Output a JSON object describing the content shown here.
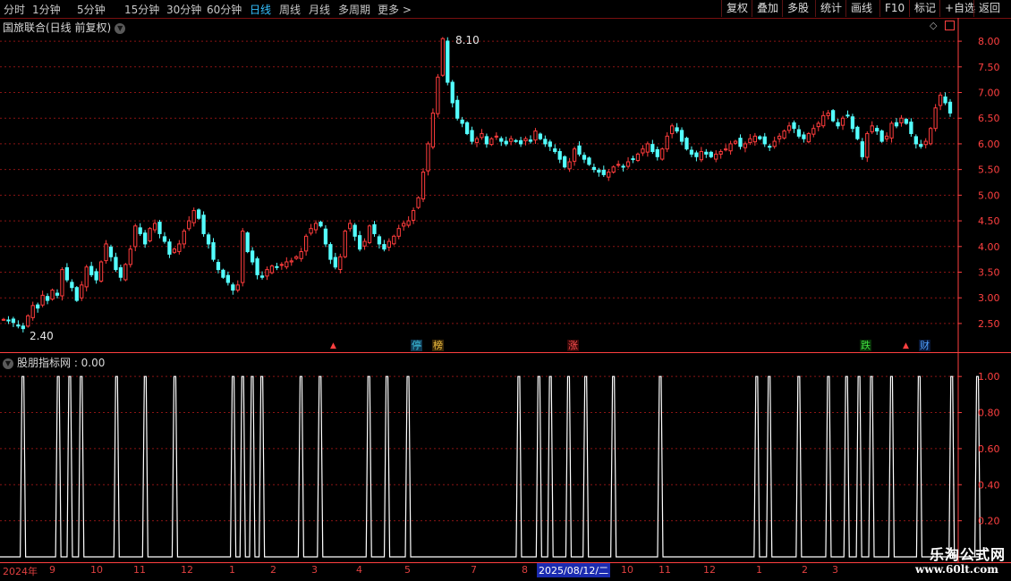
{
  "toolbar": {
    "periods": [
      "分时",
      "1分钟",
      "5分钟",
      "15分钟",
      "30分钟",
      "60分钟",
      "日线",
      "周线",
      "月线",
      "多周期",
      "更多"
    ],
    "active_period": "日线",
    "more_arrow": ">",
    "buttons": [
      "复权",
      "叠加",
      "多股",
      "统计",
      "画线",
      "F10",
      "标记",
      "+自选",
      "返回"
    ]
  },
  "main_title": "国旅联合(日线 前复权)",
  "indicator_title": "股朋指标网 : 0.00",
  "markers": [
    {
      "text": "停",
      "color": "#3fc8e6",
      "bg": "#103850"
    },
    {
      "text": "榜",
      "color": "#f0c040",
      "bg": "#3a2808"
    },
    {
      "text": "涨",
      "color": "#ff5050",
      "bg": "#3a0808"
    },
    {
      "text": "跌",
      "color": "#40e040",
      "bg": "#083008"
    },
    {
      "text": "财",
      "color": "#50a0ff",
      "bg": "#081838"
    }
  ],
  "annotations": {
    "high": "8.10",
    "low": "2.40"
  },
  "date_axis": {
    "labels": [
      "2024年",
      "9",
      "10",
      "11",
      "12",
      "1",
      "2",
      "3",
      "4",
      "5",
      "7",
      "8",
      "10",
      "11",
      "12",
      "1",
      "2",
      "3"
    ],
    "selected": "2025/08/12/二"
  },
  "watermark": {
    "line1": "乐淘公式网",
    "line2": "www.60lt.com"
  },
  "colors": {
    "up": "#ff3c3c",
    "down": "#54ffff",
    "grid": "#8a1414",
    "axis": "#ff4040"
  },
  "chart_data": [
    {
      "type": "candlestick",
      "title": "国旅联合(日线 前复权)",
      "ylim": [
        2.15,
        8.35
      ],
      "y_ticks": [
        2.5,
        3.0,
        3.5,
        4.0,
        4.5,
        5.0,
        5.5,
        6.0,
        6.5,
        7.0,
        7.5,
        8.0
      ],
      "closes": [
        2.58,
        2.55,
        2.52,
        2.45,
        2.4,
        2.65,
        2.85,
        2.8,
        3.05,
        2.95,
        3.15,
        3.05,
        3.55,
        3.35,
        3.2,
        2.95,
        3.25,
        3.6,
        3.45,
        3.35,
        3.7,
        4.05,
        3.8,
        3.55,
        3.4,
        3.65,
        3.95,
        4.4,
        4.25,
        4.05,
        4.35,
        4.45,
        4.25,
        4.1,
        3.85,
        3.95,
        4.05,
        4.3,
        4.5,
        4.7,
        4.55,
        4.25,
        4.05,
        3.75,
        3.55,
        3.4,
        3.3,
        3.15,
        3.25,
        4.3,
        3.9,
        3.7,
        3.45,
        3.4,
        3.55,
        3.62,
        3.6,
        3.65,
        3.7,
        3.72,
        3.8,
        3.9,
        4.2,
        4.35,
        4.45,
        4.4,
        4.05,
        3.75,
        3.6,
        3.8,
        4.3,
        4.45,
        4.2,
        3.95,
        4.1,
        4.4,
        4.25,
        4.05,
        3.95,
        4.1,
        4.2,
        4.35,
        4.45,
        4.5,
        4.7,
        4.95,
        5.45,
        6.0,
        6.6,
        7.3,
        8.05,
        7.2,
        6.8,
        6.5,
        6.4,
        6.2,
        6.05,
        6.1,
        6.2,
        6.0,
        6.1,
        6.15,
        6.05,
        6.0,
        6.1,
        6.05,
        6.0,
        6.1,
        6.05,
        6.25,
        6.1,
        6.0,
        5.95,
        5.85,
        5.7,
        5.55,
        5.65,
        5.9,
        5.8,
        5.7,
        5.6,
        5.5,
        5.45,
        5.4,
        5.45,
        5.55,
        5.6,
        5.55,
        5.65,
        5.7,
        5.8,
        5.9,
        6.0,
        5.85,
        5.75,
        5.9,
        6.15,
        6.35,
        6.25,
        6.05,
        5.9,
        5.8,
        5.75,
        5.85,
        5.8,
        5.75,
        5.8,
        5.85,
        5.9,
        6.0,
        6.05,
        5.95,
        6.0,
        6.1,
        6.15,
        6.1,
        6.0,
        5.95,
        6.05,
        6.15,
        6.25,
        6.35,
        6.3,
        6.15,
        6.1,
        6.2,
        6.3,
        6.4,
        6.55,
        6.6,
        6.45,
        6.35,
        6.5,
        6.55,
        6.3,
        6.1,
        5.75,
        6.2,
        6.35,
        6.25,
        6.05,
        6.15,
        6.4,
        6.35,
        6.5,
        6.4,
        6.2,
        6.0,
        5.95,
        6.05,
        6.3,
        6.7,
        6.95,
        6.8,
        6.6
      ]
    },
    {
      "type": "line",
      "title": "股朋指标网",
      "ylim": [
        0,
        1.1
      ],
      "y_ticks": [
        0.2,
        0.4,
        0.6,
        0.8,
        1.0
      ],
      "current_value": 0.0,
      "spikes_x_fraction": [
        0.024,
        0.061,
        0.073,
        0.085,
        0.122,
        0.152,
        0.183,
        0.244,
        0.254,
        0.264,
        0.274,
        0.315,
        0.335,
        0.386,
        0.405,
        0.427,
        0.543,
        0.564,
        0.576,
        0.595,
        0.613,
        0.642,
        0.691,
        0.792,
        0.805,
        0.836,
        0.867,
        0.886,
        0.899,
        0.912,
        0.933,
        0.962,
        0.996,
        1.023
      ]
    }
  ]
}
